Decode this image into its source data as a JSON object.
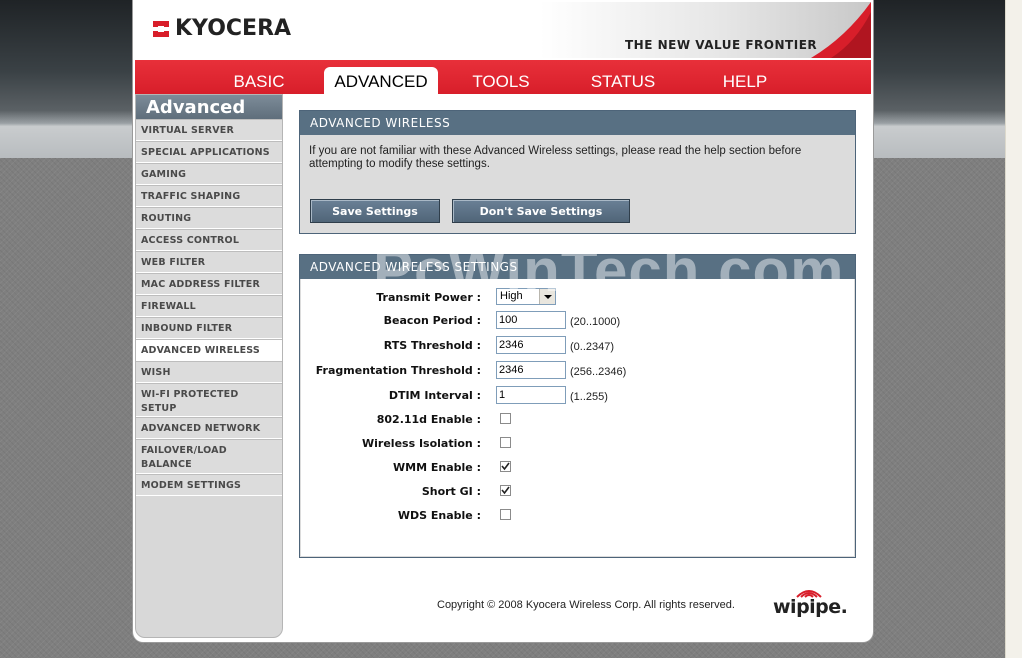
{
  "header": {
    "logo_text": "KYOCERA",
    "tagline": "THE NEW VALUE FRONTIER"
  },
  "nav": {
    "tabs": [
      {
        "label": "BASIC"
      },
      {
        "label": "ADVANCED"
      },
      {
        "label": "TOOLS"
      },
      {
        "label": "STATUS"
      },
      {
        "label": "HELP"
      }
    ],
    "active": "ADVANCED"
  },
  "sidebar": {
    "title": "Advanced",
    "items": [
      {
        "label": "VIRTUAL SERVER"
      },
      {
        "label": "SPECIAL APPLICATIONS"
      },
      {
        "label": "GAMING"
      },
      {
        "label": "TRAFFIC SHAPING"
      },
      {
        "label": "ROUTING"
      },
      {
        "label": "ACCESS CONTROL"
      },
      {
        "label": "WEB FILTER"
      },
      {
        "label": "MAC ADDRESS FILTER"
      },
      {
        "label": "FIREWALL"
      },
      {
        "label": "INBOUND FILTER"
      },
      {
        "label": "ADVANCED WIRELESS"
      },
      {
        "label": "WISH"
      },
      {
        "label": "WI-FI PROTECTED SETUP"
      },
      {
        "label": "ADVANCED NETWORK"
      },
      {
        "label": "FAILOVER/LOAD BALANCE"
      },
      {
        "label": "MODEM SETTINGS"
      }
    ]
  },
  "intro_panel": {
    "title": "ADVANCED WIRELESS",
    "text": "If you are not familiar with these Advanced Wireless settings, please read the help section before attempting to modify these settings.",
    "save_label": "Save Settings",
    "dont_save_label": "Don't Save Settings"
  },
  "settings_panel": {
    "title": "ADVANCED WIRELESS SETTINGS",
    "transmit_power": {
      "label": "Transmit Power :",
      "value": "High"
    },
    "beacon_period": {
      "label": "Beacon Period :",
      "value": "100",
      "range": "(20..1000)"
    },
    "rts_threshold": {
      "label": "RTS Threshold :",
      "value": "2346",
      "range": "(0..2347)"
    },
    "fragmentation_threshold": {
      "label": "Fragmentation Threshold :",
      "value": "2346",
      "range": "(256..2346)"
    },
    "dtim_interval": {
      "label": "DTIM Interval :",
      "value": "1",
      "range": "(1..255)"
    },
    "checks": [
      {
        "label": "802.11d Enable :",
        "checked": false
      },
      {
        "label": "Wireless Isolation :",
        "checked": false
      },
      {
        "label": "WMM Enable :",
        "checked": true
      },
      {
        "label": "Short GI :",
        "checked": true
      },
      {
        "label": "WDS Enable :",
        "checked": false
      }
    ]
  },
  "footer": {
    "copyright": "Copyright © 2008 Kyocera Wireless Corp. All rights reserved.",
    "brand": "wipipe."
  },
  "watermark": "PcWinTech.com",
  "colors": {
    "nav_red": "#d81e2a",
    "panel_header": "#587083",
    "button": "#5a6f83"
  }
}
